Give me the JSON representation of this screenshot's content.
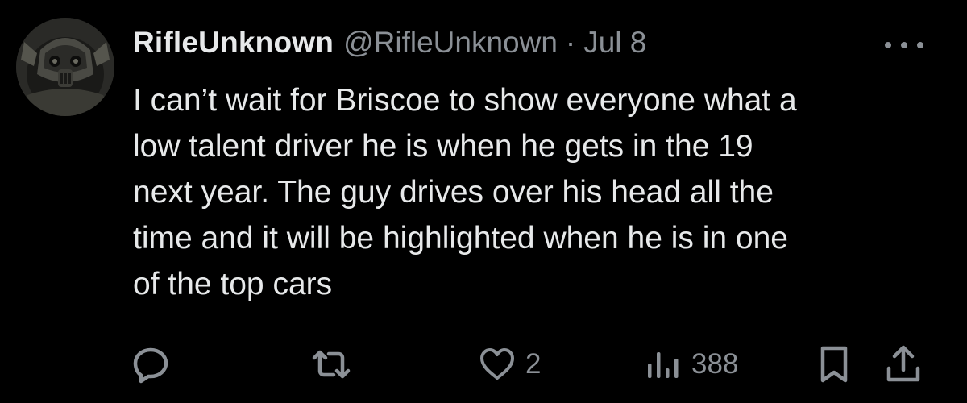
{
  "tweet": {
    "display_name": "RifleUnknown",
    "handle": "@RifleUnknown",
    "separator": "·",
    "date": "Jul 8",
    "text_lines": [
      "I can’t wait for Briscoe to show everyone what a",
      "low talent driver he is when he gets in the 19",
      "next year. The guy drives over his head all the",
      "time and it will be highlighted when he is in one",
      "of the top cars"
    ]
  },
  "actions": {
    "reply_icon": "reply-icon",
    "repost_icon": "repost-icon",
    "like_icon": "heart-icon",
    "like_count": "2",
    "views_icon": "views-icon",
    "views_count": "388",
    "bookmark_icon": "bookmark-icon",
    "share_icon": "share-icon"
  },
  "colors": {
    "background": "#000000",
    "primary_text": "#e7e9ea",
    "secondary_text": "#8b9096"
  }
}
